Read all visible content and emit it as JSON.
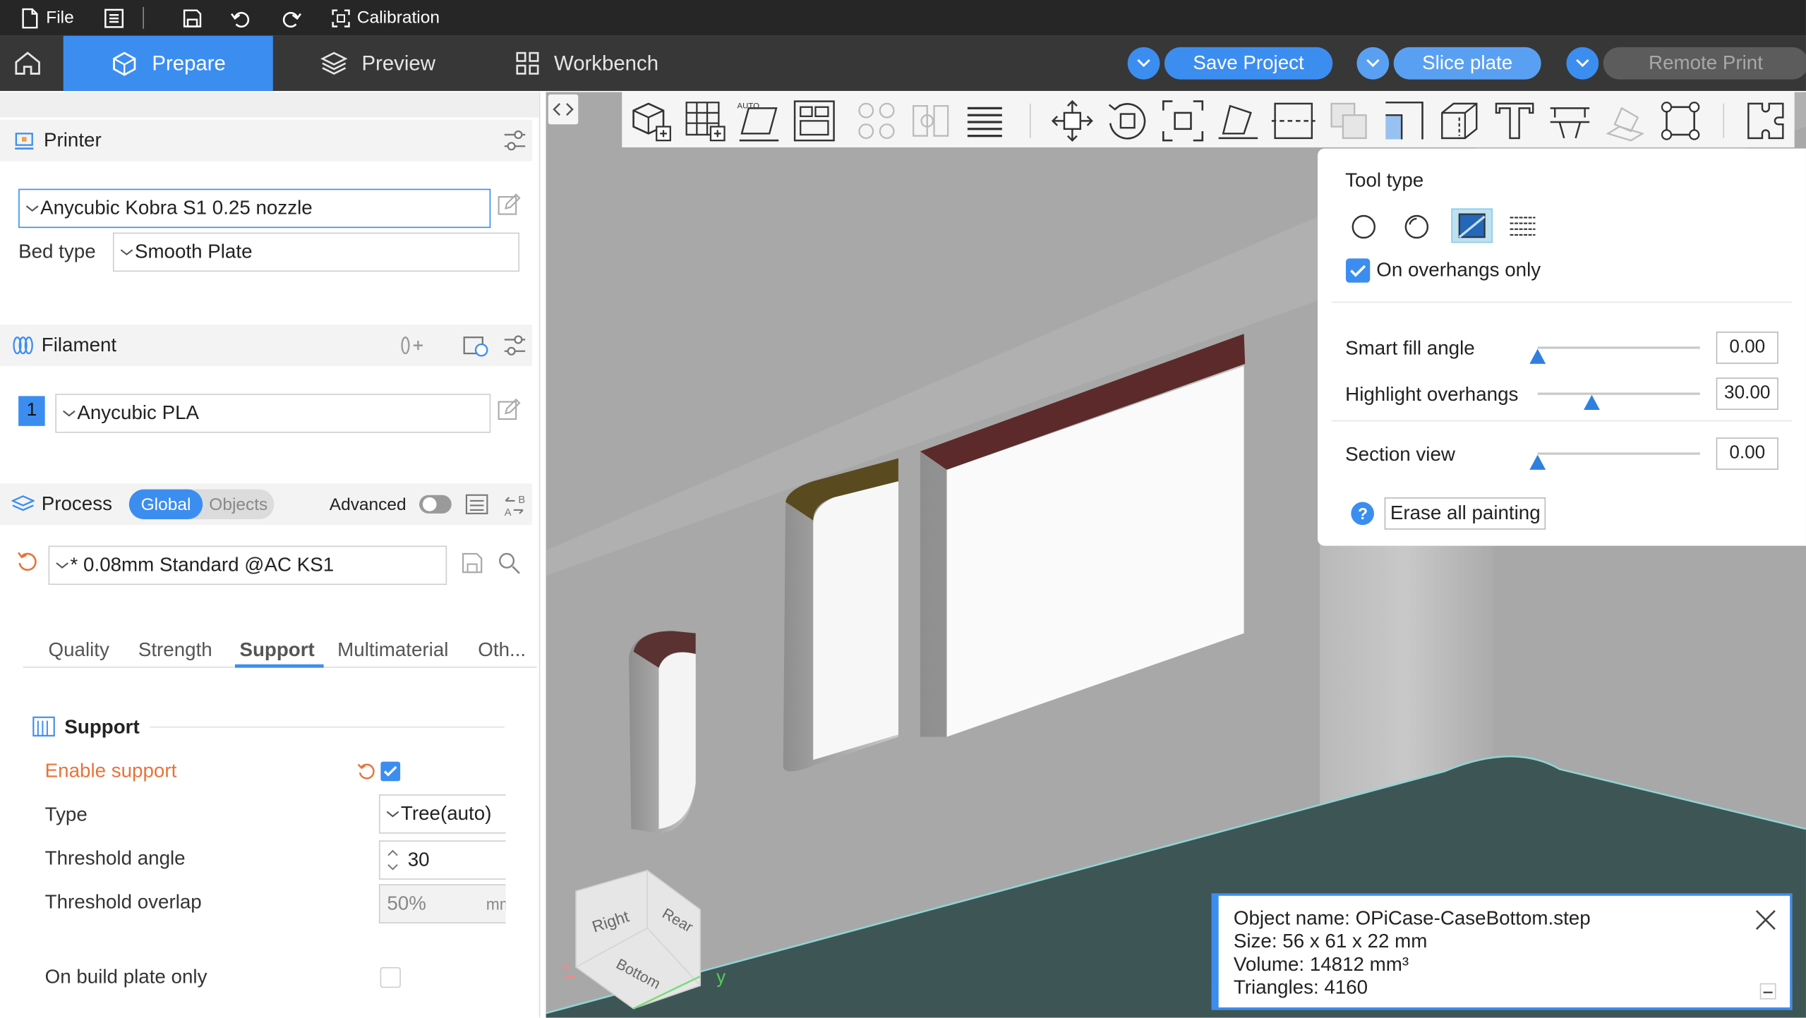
{
  "menubar": {
    "file": "File",
    "calibration": "Calibration"
  },
  "nav": {
    "tabs": [
      {
        "label": "Prepare"
      },
      {
        "label": "Preview"
      },
      {
        "label": "Workbench"
      }
    ],
    "save_project": "Save Project",
    "slice_plate": "Slice plate",
    "remote_print": "Remote Print"
  },
  "printer": {
    "title": "Printer",
    "selected": "Anycubic Kobra S1 0.25 nozzle",
    "bed_type_label": "Bed type",
    "bed_type": "Smooth Plate"
  },
  "filament": {
    "title": "Filament",
    "slot": "1",
    "selected": "Anycubic PLA"
  },
  "process": {
    "title": "Process",
    "toggle_global": "Global",
    "toggle_objects": "Objects",
    "advanced_label": "Advanced",
    "preset": "* 0.08mm Standard @AC KS1",
    "tabs": [
      "Quality",
      "Strength",
      "Support",
      "Multimaterial",
      "Oth..."
    ],
    "active_tab": "Support"
  },
  "support": {
    "section": "Support",
    "enable_support": "Enable support",
    "type_label": "Type",
    "type_value": "Tree(auto)",
    "threshold_angle_label": "Threshold angle",
    "threshold_angle_value": "30",
    "threshold_overlap_label": "Threshold overlap",
    "threshold_overlap_value": "50%",
    "threshold_overlap_unit": "mm",
    "on_build_plate_only": "On build plate only"
  },
  "paint_panel": {
    "tool_type": "Tool type",
    "on_overhangs_only": "On overhangs only",
    "smart_fill_angle": "Smart fill angle",
    "smart_fill_value": "0.00",
    "highlight_overhangs": "Highlight overhangs",
    "highlight_value": "30.00",
    "section_view": "Section view",
    "section_value": "0.00",
    "erase_all": "Erase all painting",
    "smart_fill_fraction": 0.0,
    "highlight_fraction": 0.33,
    "section_fraction": 0.0
  },
  "view_cube": {
    "right": "Right",
    "rear": "Rear",
    "bottom": "Bottom",
    "x_axis": "x",
    "y_axis": "y"
  },
  "object_info": {
    "name": "Object name: OPiCase-CaseBottom.step",
    "size": "Size: 56 x 61 x 22 mm",
    "volume": "Volume: 14812 mm³",
    "triangles": "Triangles: 4160"
  },
  "colors": {
    "accent": "#3c8df0",
    "orange": "#e8733a",
    "bed": "#3e5555",
    "overhang": "#5c2a2a"
  },
  "icons": [
    "file-icon",
    "list-icon",
    "save-icon",
    "undo-icon",
    "redo-icon",
    "calibration-icon",
    "home-icon",
    "prepare-icon",
    "preview-icon",
    "workbench-icon"
  ]
}
